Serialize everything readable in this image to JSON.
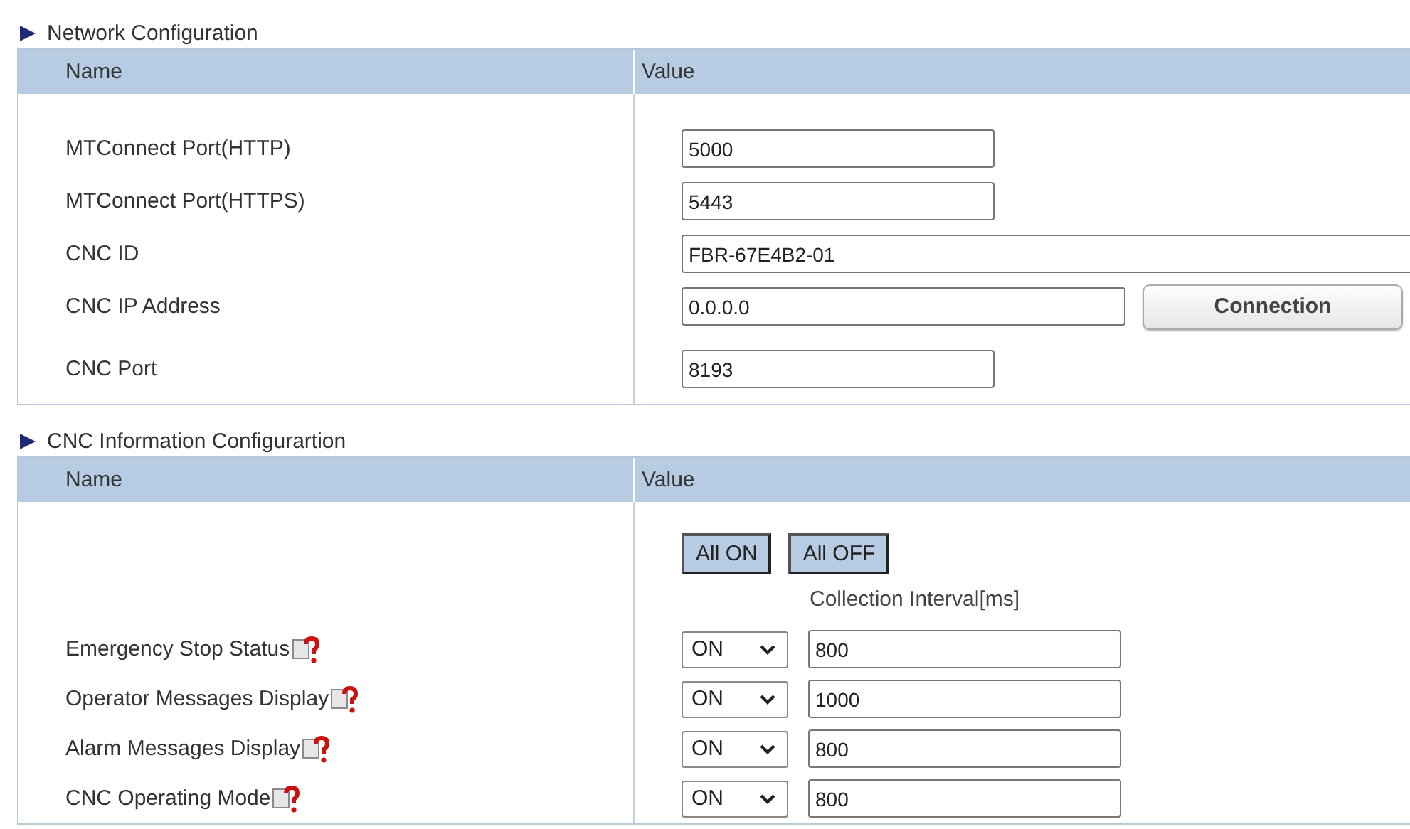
{
  "sections": [
    {
      "kind": "network",
      "title": "Network Configuration",
      "columns": [
        "Name",
        "Value"
      ],
      "rows": [
        {
          "kind": "short",
          "name": "MTConnect Port(HTTP)",
          "value": "5000"
        },
        {
          "kind": "short",
          "name": "MTConnect Port(HTTPS)",
          "value": "5443"
        },
        {
          "kind": "wide",
          "name": "CNC ID",
          "value": "FBR-67E4B2-01"
        },
        {
          "kind": "with_button",
          "name": "CNC IP Address",
          "value": "0.0.0.0",
          "button": "Connection"
        },
        {
          "kind": "short",
          "name": "CNC Port",
          "value": "8193"
        }
      ]
    },
    {
      "kind": "collection",
      "title": "CNC Information Configurartion",
      "columns": [
        "Name",
        "Value"
      ],
      "toggle_buttons": [
        "All ON",
        "All OFF"
      ],
      "interval_heading": "Collection Interval[ms]",
      "items": [
        {
          "name": "Emergency Stop Status",
          "state": "ON",
          "interval": "800"
        },
        {
          "name": "Operator Messages Display",
          "state": "ON",
          "interval": "1000"
        },
        {
          "name": "Alarm Messages Display",
          "state": "ON",
          "interval": "800"
        },
        {
          "name": "CNC Operating Mode",
          "state": "ON",
          "interval": "800"
        }
      ]
    }
  ]
}
